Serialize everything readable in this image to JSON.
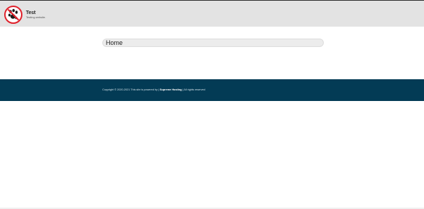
{
  "header": {
    "site_title": "Test",
    "site_tagline": "Testing website.",
    "logo_icon": "no-pets-paw-icon",
    "logo_colors": {
      "ring": "#e0202a",
      "paw": "#1a1a1a",
      "fill": "#ffffff"
    }
  },
  "main": {
    "page_title": "Home"
  },
  "footer": {
    "copyright_prefix": "Copyright © 2020-2021 This site is powered by | ",
    "powered_by": "Supreme Hosting",
    "rights": " | All rights reserved",
    "background": "#033b55"
  }
}
